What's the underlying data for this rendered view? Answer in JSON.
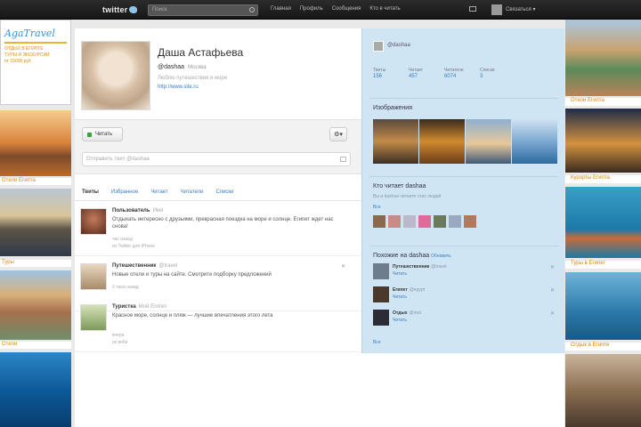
{
  "topbar": {
    "logo": "twitter",
    "search_placeholder": "Поиск",
    "nav": [
      "Главная",
      "Профиль",
      "Сообщения",
      "Кто в читать"
    ],
    "username": "Связаться"
  },
  "left_column": {
    "promo_logo": "AgaTravel",
    "promo_lines": [
      "ОТДЫХ В ЕГИПТЕ",
      "ТУРЫ И ЭКСКУРСИИ",
      "от 15000 руб"
    ],
    "labels": [
      "Отели Египта",
      "Туры",
      "Отели"
    ]
  },
  "right_column": {
    "labels": [
      "Отели Египта",
      "Курорты Египта",
      "Туры в Египет",
      "Отдых в Египте"
    ]
  },
  "profile": {
    "name": "Даша Астафьева",
    "handle": "@dashaa",
    "location": "Москва",
    "bio": "Люблю путешествия и море",
    "url": "http://www.site.ru"
  },
  "actions": {
    "follow_label": "Читать",
    "gear_label": "⚙▾",
    "tweet_placeholder": "Отправить твит @dashaa"
  },
  "tabs": [
    "Твиты",
    "Избранное",
    "Читает",
    "Читатели",
    "Списки"
  ],
  "tweets": [
    {
      "user": "Пользователь",
      "screen": "Имя",
      "text": "Отдыхать интересно с друзьями, прекрасная поездка на море и солнце. Египет ждет нас снова!",
      "time": "час назад",
      "meta": "из Twitter для iPhone"
    },
    {
      "user": "Путешественник",
      "screen": "@travel",
      "text": "Новые отели и туры на сайте. Смотрите подборку предложений",
      "time": "",
      "meta": "2 часа назад"
    },
    {
      "user": "Туристка",
      "screen": "Мой Египет",
      "text": "Красное море, солнце и пляж — лучшие впечатления этого лета",
      "time": "вчера",
      "meta": "из веба"
    }
  ],
  "dashboard": {
    "handle": "@dashaa",
    "stats": [
      {
        "label": "Твиты",
        "value": "156"
      },
      {
        "label": "Читает",
        "value": "457"
      },
      {
        "label": "Читатели",
        "value": "6074"
      },
      {
        "label": "Списки",
        "value": "3"
      }
    ],
    "media_title": "Изображения",
    "followers_title": "Кто читает dashaa",
    "followers_sub": "Вы и dashaa читаете этих людей",
    "followers_link": "Все",
    "recs_title": "Похожие на dashaa",
    "recs_link": "Обновить",
    "recommendations": [
      {
        "name": "Путешественник",
        "screen": "@travel",
        "follow": "Читать"
      },
      {
        "name": "Египет",
        "screen": "@egypt",
        "follow": "Читать"
      },
      {
        "name": "Отдых",
        "screen": "@rest",
        "follow": "Читать"
      }
    ],
    "bottom_link": "Все"
  }
}
